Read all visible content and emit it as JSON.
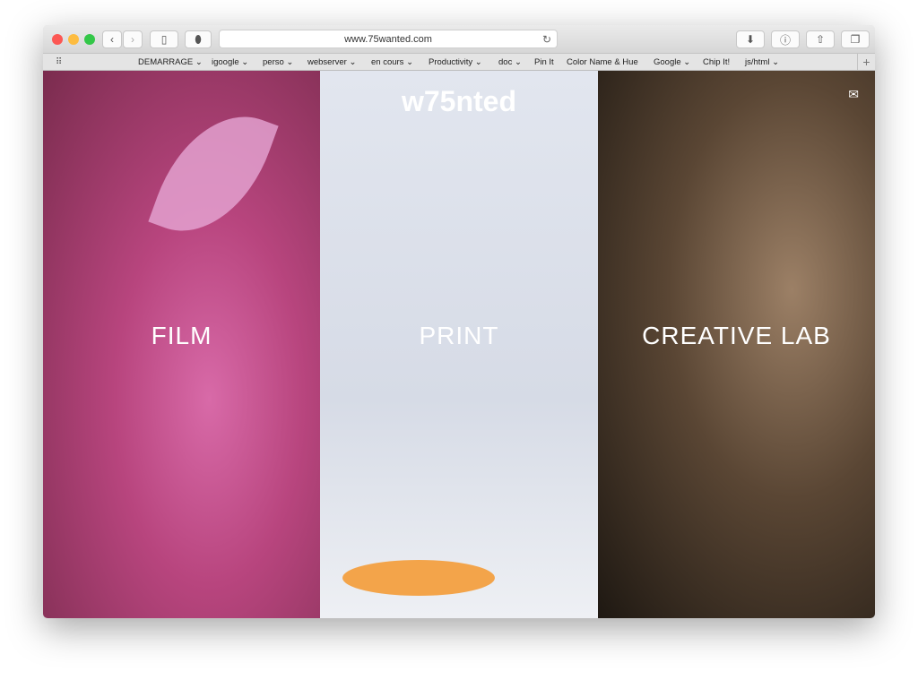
{
  "browser": {
    "url": "www.75wanted.com",
    "bookmarks": [
      "DEMARRAGE ⌄",
      "igoogle ⌄",
      "perso ⌄",
      "webserver ⌄",
      "en cours ⌄",
      "Productivity ⌄",
      "doc ⌄",
      "Pin It",
      "Color Name & Hue",
      "Google ⌄",
      "Chip It!",
      "js/html ⌄"
    ]
  },
  "site": {
    "logo": "w75nted",
    "sections": [
      {
        "label": "FILM"
      },
      {
        "label": "PRINT"
      },
      {
        "label": "CREATIVE LAB"
      }
    ]
  },
  "colors": {
    "close": "#fc5753",
    "minimize": "#fdbc40",
    "zoom": "#33c748"
  }
}
